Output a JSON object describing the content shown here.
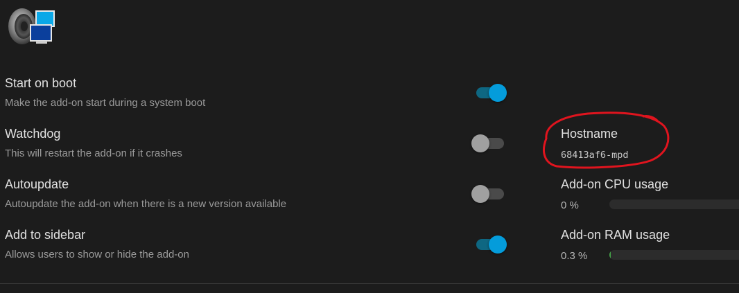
{
  "options": [
    {
      "title": "Start on boot",
      "description": "Make the add-on start during a system boot",
      "enabled": true
    },
    {
      "title": "Watchdog",
      "description": "This will restart the add-on if it crashes",
      "enabled": false
    },
    {
      "title": "Autoupdate",
      "description": "Autoupdate the add-on when there is a new version available",
      "enabled": false
    },
    {
      "title": "Add to sidebar",
      "description": "Allows users to show or hide the add-on",
      "enabled": true
    }
  ],
  "info": {
    "hostname_label": "Hostname",
    "hostname_value": "68413af6-mpd",
    "cpu_label": "Add-on CPU usage",
    "cpu_value": "0 %",
    "cpu_fraction": 0.0,
    "ram_label": "Add-on RAM usage",
    "ram_value": "0.3 %",
    "ram_fraction": 0.003
  },
  "colors": {
    "toggle_on_thumb": "#049cdb",
    "toggle_on_track": "#0e6782",
    "toggle_off_thumb": "#a0a0a0",
    "toggle_off_track": "#4a4a4a",
    "annotation": "#e0141e",
    "bar_fill": "#43a047"
  },
  "icons": {
    "logo": "speaker-monitor-icon"
  }
}
